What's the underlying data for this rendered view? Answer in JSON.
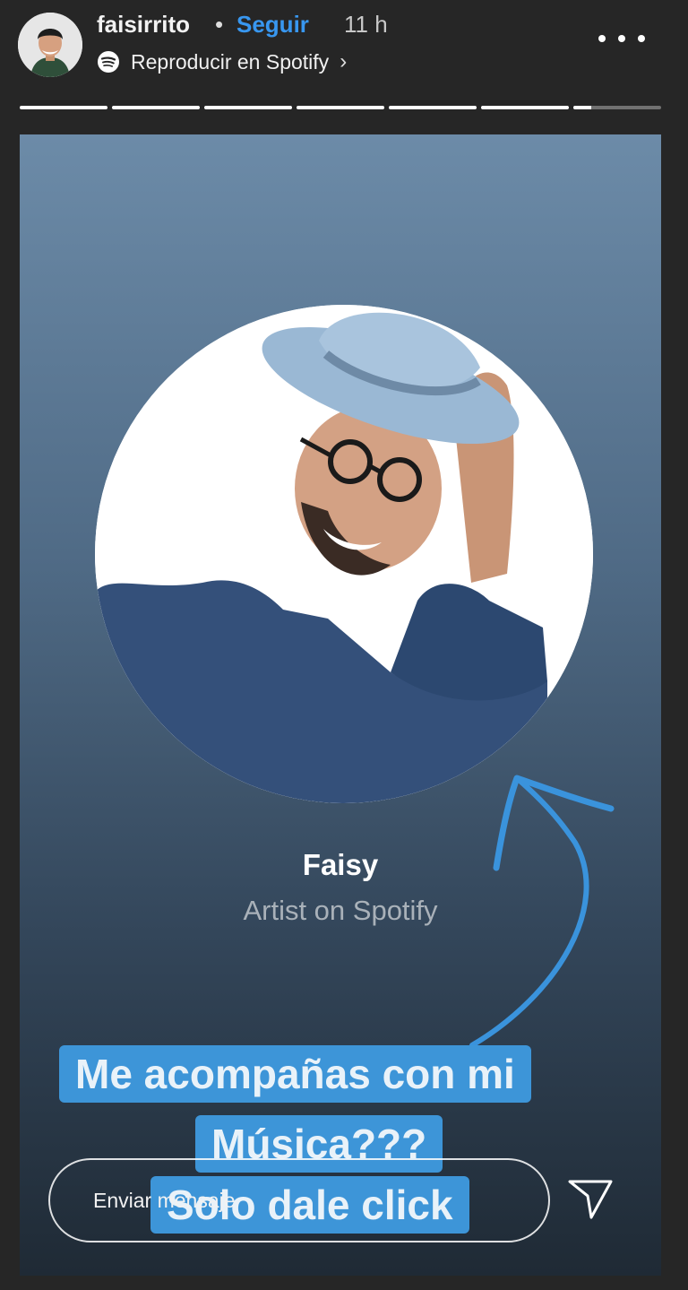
{
  "header": {
    "username": "faisirrito",
    "separator": "•",
    "follow_label": "Seguir",
    "time_ago": "11 h",
    "spotify_link": "Reproducir en Spotify",
    "spotify_chevron": "›",
    "progress_segments": [
      1,
      1,
      1,
      1,
      1,
      1,
      0.2
    ]
  },
  "icons": {
    "avatar": "profile-avatar",
    "spotify": "spotify-icon",
    "more": "more-options-icon",
    "send": "send-direct-icon"
  },
  "story": {
    "artist_name": "Faisy",
    "artist_subtitle": "Artist on Spotify",
    "caption_lines": [
      "Me acompañas con mi",
      "Música???",
      "Solo dale click"
    ]
  },
  "composer": {
    "placeholder": "Enviar mensaje"
  },
  "colors": {
    "follow": "#3897f0",
    "caption_bg": "#3d95d8",
    "arrow": "#3a93dc"
  }
}
